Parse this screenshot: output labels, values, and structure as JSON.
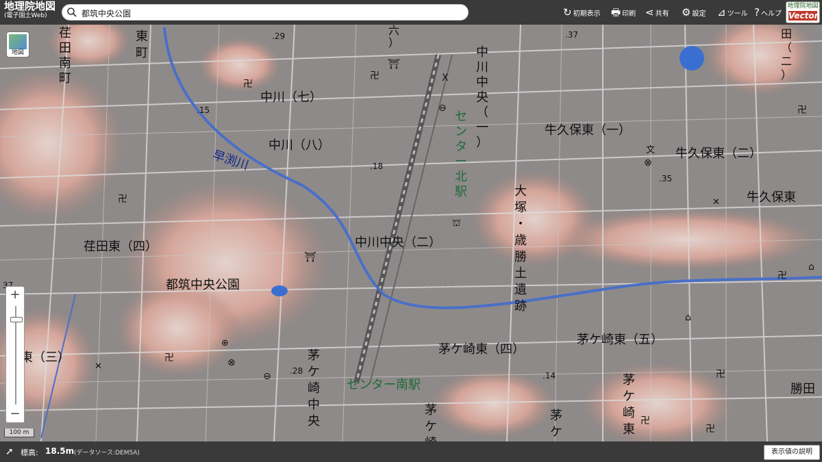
{
  "app": {
    "logo_line1": "地理院地図",
    "logo_line2": "(電子国土Web)",
    "vector_line1": "地理院地図",
    "vector_line2": "Vector"
  },
  "search": {
    "value": "都筑中央公園"
  },
  "menu": {
    "reset": "初期表示",
    "print": "印刷",
    "share": "共有",
    "settings": "設定",
    "tools": "ツール",
    "help": "ヘルプ"
  },
  "layer_button": {
    "label": "地図"
  },
  "zoom": {
    "in": "+",
    "out": "−"
  },
  "scale": {
    "label": "100 m"
  },
  "elevation": {
    "label": "標高:",
    "value": "18.5m",
    "source": "(データソース:DEM5A)",
    "explain_button": "表示値の説明"
  },
  "map_labels": {
    "konda_minami": [
      "荏",
      "田",
      "南",
      "町"
    ],
    "higashi": [
      "東",
      "町"
    ],
    "roku": [
      "六",
      "）"
    ],
    "nakagawa7": "中川（七）",
    "nakagawa8": "中川（八）",
    "nakagawa_chuo1": [
      "中",
      "川",
      "中",
      "央",
      "（",
      "一",
      "）"
    ],
    "center_kita": [
      "セ",
      "ン",
      "タ",
      "ー",
      "北",
      "駅"
    ],
    "ushikubo_higashi1": "牛久保東（一）",
    "ushikubo_higashi2": "牛久保東（二）",
    "ushikubo_higashi": "牛久保東",
    "den": [
      "田",
      "（",
      "二",
      "）"
    ],
    "hayabuchi": "早渕川",
    "konda_higashi4": "荏田東（四）",
    "tsuzuki_chuo_koen": "都筑中央公園",
    "nakagawa_chuo2": "中川中央（二）",
    "otsuka": [
      "大",
      "塚",
      "・",
      "歳",
      "勝",
      "土",
      "遺",
      "跡"
    ],
    "kayasaki_higashi5": "茅ケ崎東（五）",
    "kayasaki_higashi4": "茅ケ崎東（四）",
    "kayasaki_chuo": [
      "茅",
      "ケ",
      "崎",
      "中",
      "央"
    ],
    "center_minami": "センター南駅",
    "kayasaki": [
      "茅",
      "ケ",
      "崎"
    ],
    "kayasaki2": [
      "茅",
      "ケ"
    ],
    "kayasaki_higashi_v": [
      "茅",
      "ケ",
      "崎",
      "東"
    ],
    "katsuda": "勝田",
    "higashi3": "東（三）",
    "den2": "田",
    "h29": ".29",
    "h37": ".37",
    "h15": ".15",
    "h18": ".18",
    "h35": ".35",
    "h28": ".28",
    "h14": ".14",
    "h37b": "37"
  }
}
